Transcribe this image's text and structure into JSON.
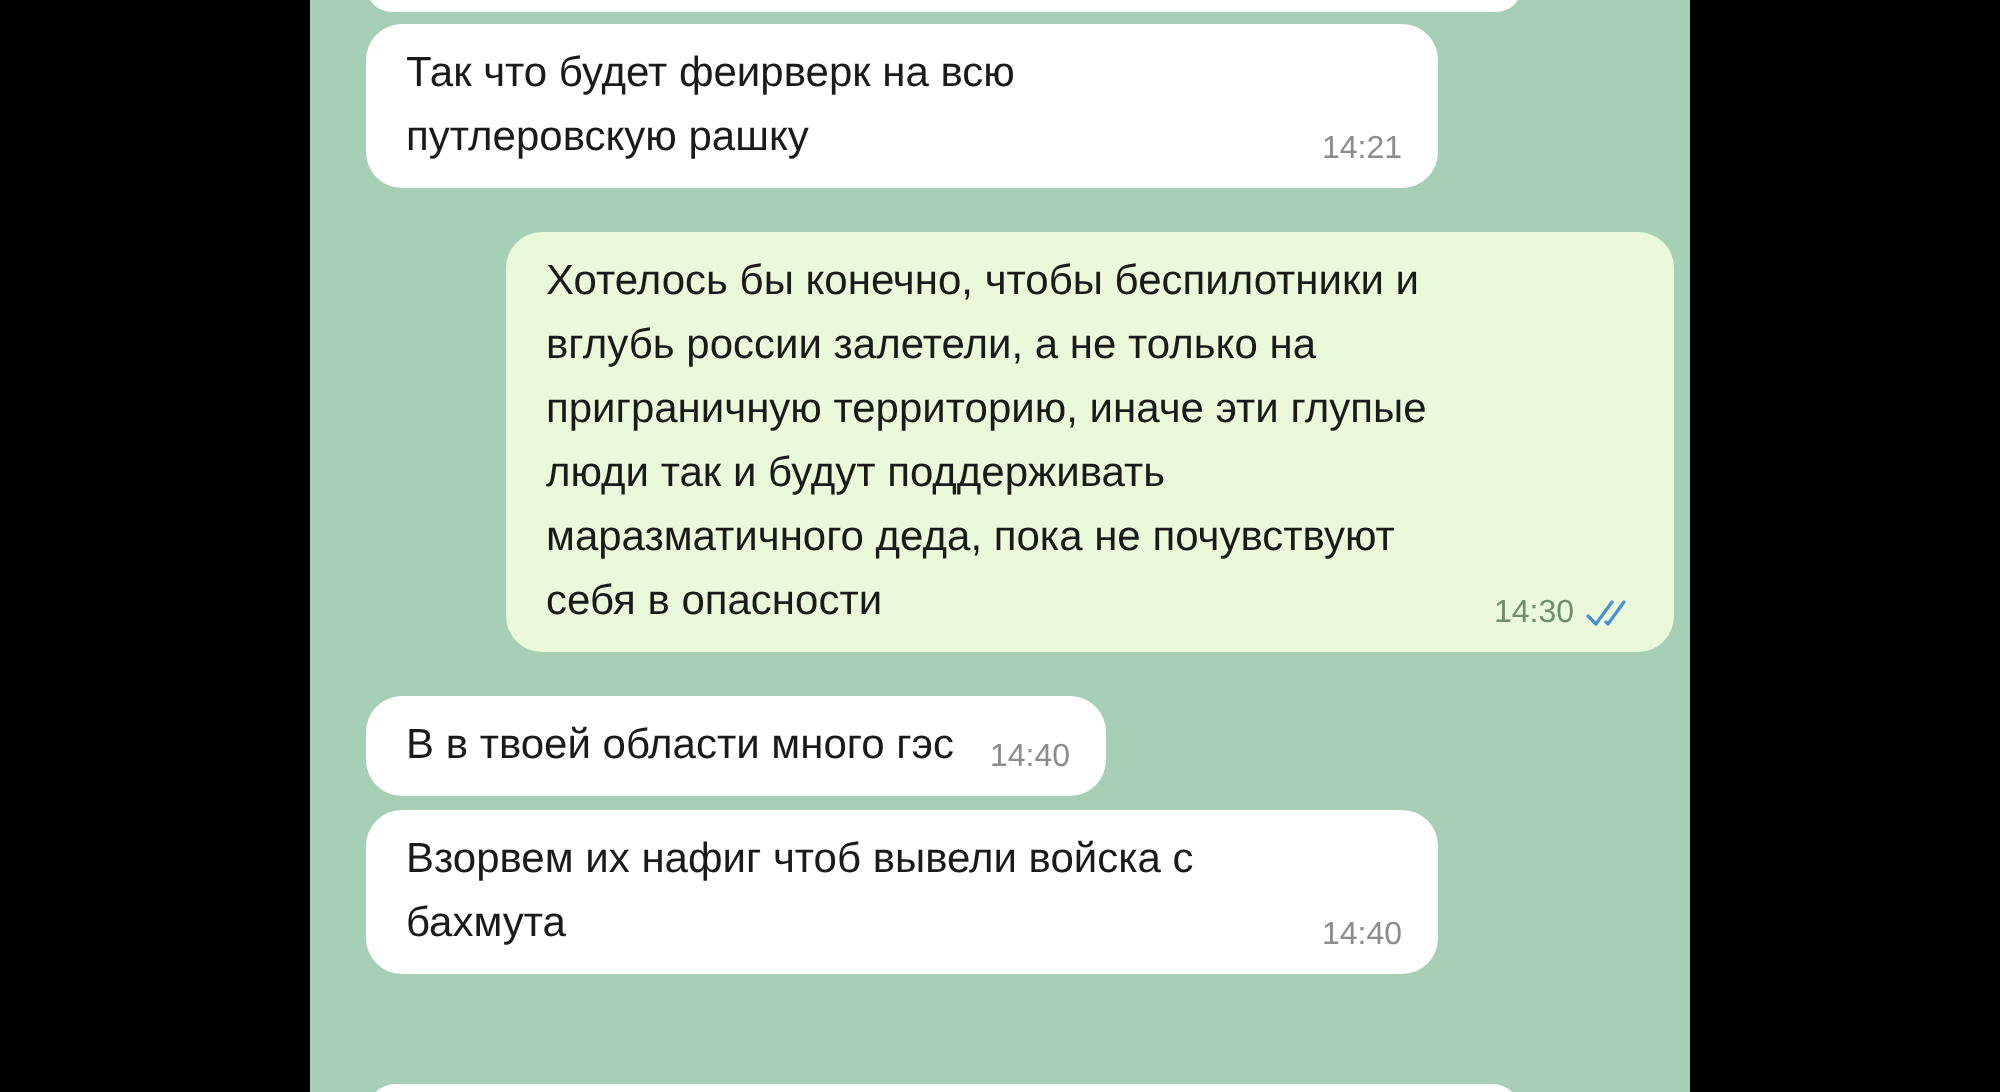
{
  "messages": [
    {
      "kind": "incoming",
      "text": "Так что будет феирверк на всю путлеровскую рашку",
      "time": "14:21"
    },
    {
      "kind": "outgoing",
      "text": "Хотелось бы конечно, чтобы беспилотники и вглубь россии залетели, а не только на приграничную территорию, иначе эти глупые люди так и будут поддерживать маразматичного деда, пока не почувствуют себя в опасности",
      "time": "14:30",
      "read": true
    },
    {
      "kind": "incoming",
      "text": "В в твоей области много гэс",
      "time": "14:40"
    },
    {
      "kind": "incoming",
      "text": "Взорвем их нафиг чтоб вывели войска с бахмута",
      "time": "14:40"
    }
  ]
}
